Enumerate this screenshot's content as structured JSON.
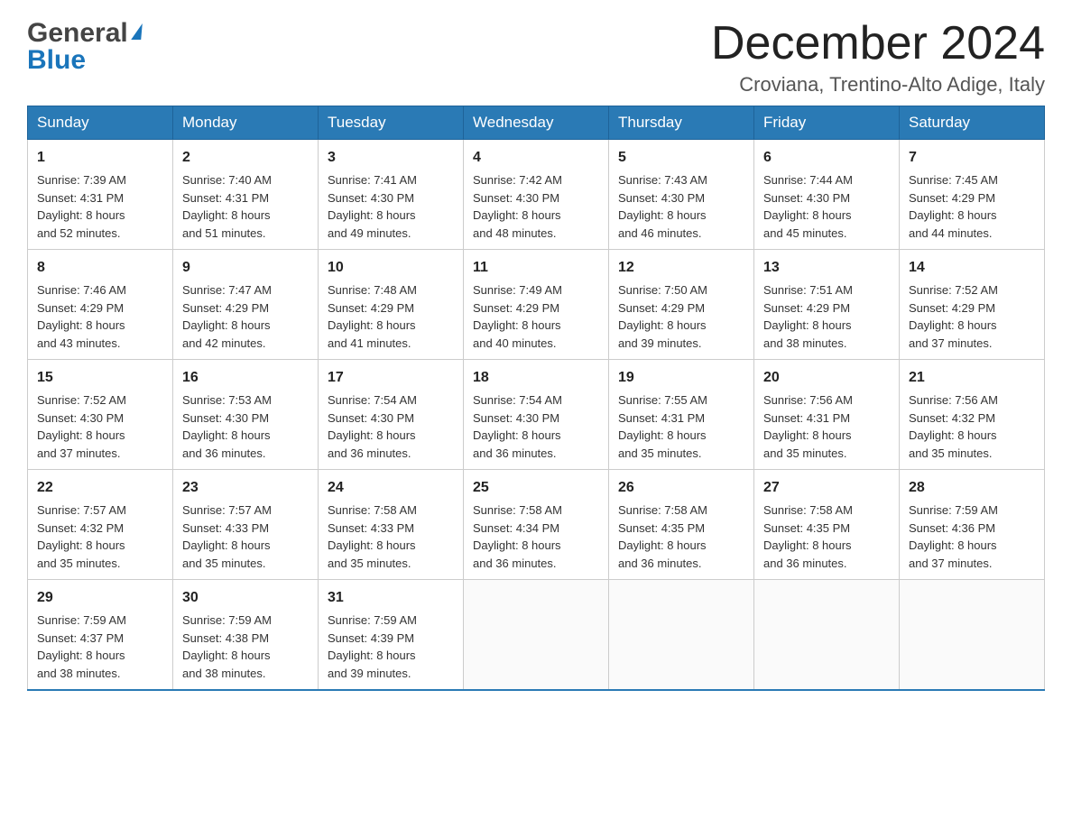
{
  "header": {
    "logo_general": "General",
    "logo_blue": "Blue",
    "title": "December 2024",
    "subtitle": "Croviana, Trentino-Alto Adige, Italy"
  },
  "weekdays": [
    "Sunday",
    "Monday",
    "Tuesday",
    "Wednesday",
    "Thursday",
    "Friday",
    "Saturday"
  ],
  "weeks": [
    [
      {
        "day": "1",
        "sunrise": "7:39 AM",
        "sunset": "4:31 PM",
        "daylight": "8 hours and 52 minutes."
      },
      {
        "day": "2",
        "sunrise": "7:40 AM",
        "sunset": "4:31 PM",
        "daylight": "8 hours and 51 minutes."
      },
      {
        "day": "3",
        "sunrise": "7:41 AM",
        "sunset": "4:30 PM",
        "daylight": "8 hours and 49 minutes."
      },
      {
        "day": "4",
        "sunrise": "7:42 AM",
        "sunset": "4:30 PM",
        "daylight": "8 hours and 48 minutes."
      },
      {
        "day": "5",
        "sunrise": "7:43 AM",
        "sunset": "4:30 PM",
        "daylight": "8 hours and 46 minutes."
      },
      {
        "day": "6",
        "sunrise": "7:44 AM",
        "sunset": "4:30 PM",
        "daylight": "8 hours and 45 minutes."
      },
      {
        "day": "7",
        "sunrise": "7:45 AM",
        "sunset": "4:29 PM",
        "daylight": "8 hours and 44 minutes."
      }
    ],
    [
      {
        "day": "8",
        "sunrise": "7:46 AM",
        "sunset": "4:29 PM",
        "daylight": "8 hours and 43 minutes."
      },
      {
        "day": "9",
        "sunrise": "7:47 AM",
        "sunset": "4:29 PM",
        "daylight": "8 hours and 42 minutes."
      },
      {
        "day": "10",
        "sunrise": "7:48 AM",
        "sunset": "4:29 PM",
        "daylight": "8 hours and 41 minutes."
      },
      {
        "day": "11",
        "sunrise": "7:49 AM",
        "sunset": "4:29 PM",
        "daylight": "8 hours and 40 minutes."
      },
      {
        "day": "12",
        "sunrise": "7:50 AM",
        "sunset": "4:29 PM",
        "daylight": "8 hours and 39 minutes."
      },
      {
        "day": "13",
        "sunrise": "7:51 AM",
        "sunset": "4:29 PM",
        "daylight": "8 hours and 38 minutes."
      },
      {
        "day": "14",
        "sunrise": "7:52 AM",
        "sunset": "4:29 PM",
        "daylight": "8 hours and 37 minutes."
      }
    ],
    [
      {
        "day": "15",
        "sunrise": "7:52 AM",
        "sunset": "4:30 PM",
        "daylight": "8 hours and 37 minutes."
      },
      {
        "day": "16",
        "sunrise": "7:53 AM",
        "sunset": "4:30 PM",
        "daylight": "8 hours and 36 minutes."
      },
      {
        "day": "17",
        "sunrise": "7:54 AM",
        "sunset": "4:30 PM",
        "daylight": "8 hours and 36 minutes."
      },
      {
        "day": "18",
        "sunrise": "7:54 AM",
        "sunset": "4:30 PM",
        "daylight": "8 hours and 36 minutes."
      },
      {
        "day": "19",
        "sunrise": "7:55 AM",
        "sunset": "4:31 PM",
        "daylight": "8 hours and 35 minutes."
      },
      {
        "day": "20",
        "sunrise": "7:56 AM",
        "sunset": "4:31 PM",
        "daylight": "8 hours and 35 minutes."
      },
      {
        "day": "21",
        "sunrise": "7:56 AM",
        "sunset": "4:32 PM",
        "daylight": "8 hours and 35 minutes."
      }
    ],
    [
      {
        "day": "22",
        "sunrise": "7:57 AM",
        "sunset": "4:32 PM",
        "daylight": "8 hours and 35 minutes."
      },
      {
        "day": "23",
        "sunrise": "7:57 AM",
        "sunset": "4:33 PM",
        "daylight": "8 hours and 35 minutes."
      },
      {
        "day": "24",
        "sunrise": "7:58 AM",
        "sunset": "4:33 PM",
        "daylight": "8 hours and 35 minutes."
      },
      {
        "day": "25",
        "sunrise": "7:58 AM",
        "sunset": "4:34 PM",
        "daylight": "8 hours and 36 minutes."
      },
      {
        "day": "26",
        "sunrise": "7:58 AM",
        "sunset": "4:35 PM",
        "daylight": "8 hours and 36 minutes."
      },
      {
        "day": "27",
        "sunrise": "7:58 AM",
        "sunset": "4:35 PM",
        "daylight": "8 hours and 36 minutes."
      },
      {
        "day": "28",
        "sunrise": "7:59 AM",
        "sunset": "4:36 PM",
        "daylight": "8 hours and 37 minutes."
      }
    ],
    [
      {
        "day": "29",
        "sunrise": "7:59 AM",
        "sunset": "4:37 PM",
        "daylight": "8 hours and 38 minutes."
      },
      {
        "day": "30",
        "sunrise": "7:59 AM",
        "sunset": "4:38 PM",
        "daylight": "8 hours and 38 minutes."
      },
      {
        "day": "31",
        "sunrise": "7:59 AM",
        "sunset": "4:39 PM",
        "daylight": "8 hours and 39 minutes."
      },
      null,
      null,
      null,
      null
    ]
  ],
  "labels": {
    "sunrise": "Sunrise:",
    "sunset": "Sunset:",
    "daylight": "Daylight:"
  },
  "colors": {
    "header_bg": "#2a7ab5",
    "header_text": "#ffffff",
    "border": "#cccccc"
  }
}
